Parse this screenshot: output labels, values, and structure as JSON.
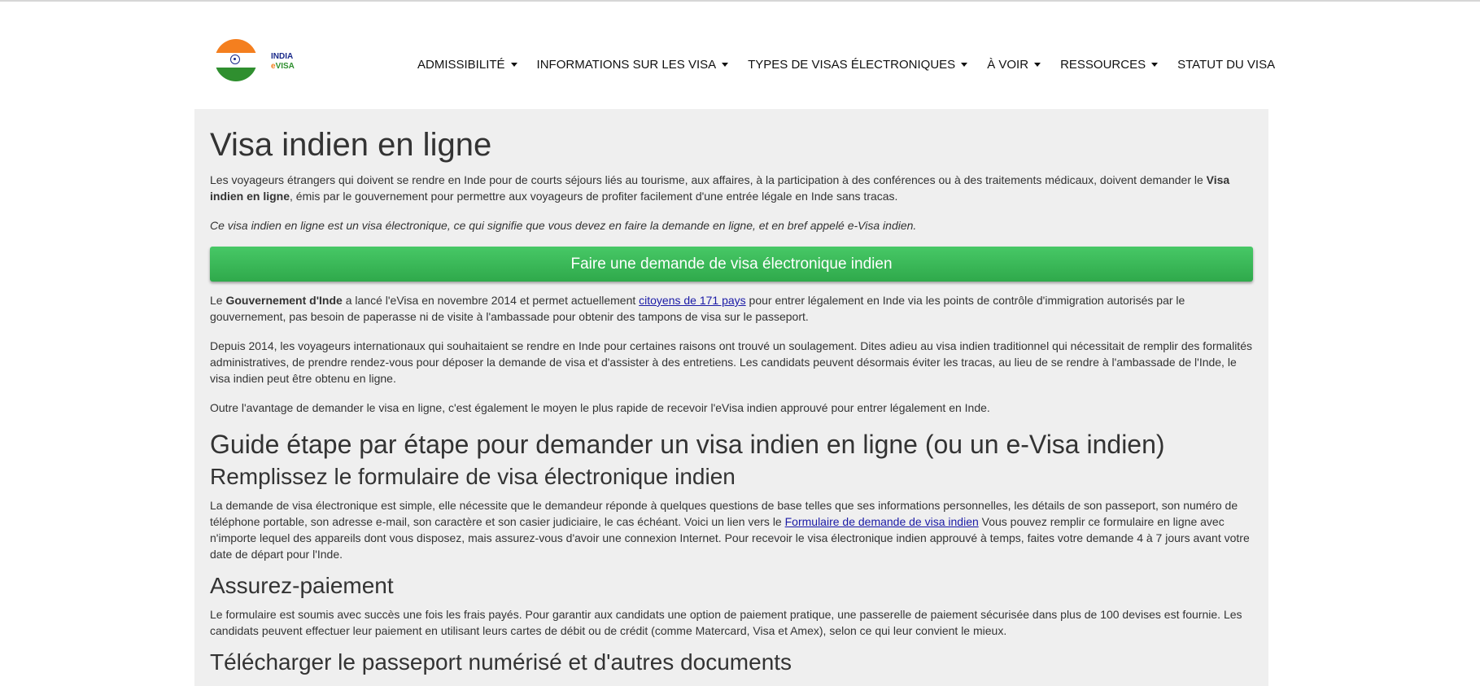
{
  "logo": {
    "line1": "INDIA",
    "line2_e": "e",
    "line2_visa": "VISA"
  },
  "nav": {
    "items": [
      {
        "label": "ADMISSIBILITÉ",
        "has_dropdown": true
      },
      {
        "label": "INFORMATIONS SUR LES VISA",
        "has_dropdown": true
      },
      {
        "label": "TYPES DE VISAS ÉLECTRONIQUES",
        "has_dropdown": true
      },
      {
        "label": "À VOIR",
        "has_dropdown": true
      },
      {
        "label": "RESSOURCES",
        "has_dropdown": true
      },
      {
        "label": "STATUT DU VISA",
        "has_dropdown": false
      }
    ]
  },
  "main": {
    "title": "Visa indien en ligne",
    "intro_before": "Les voyageurs étrangers qui doivent se rendre en Inde pour de courts séjours liés au tourisme, aux affaires, à la participation à des conférences ou à des traitements médicaux, doivent demander le ",
    "intro_bold": "Visa indien en ligne",
    "intro_after": ", émis par le gouvernement pour permettre aux voyageurs de profiter facilement d'une entrée légale en Inde sans tracas.",
    "italic_note": "Ce visa indien en ligne est un visa électronique, ce qui signifie que vous devez en faire la demande en ligne, et en bref appelé e-Visa indien.",
    "apply_button": "Faire une demande de visa électronique indien",
    "gov_before": "Le ",
    "gov_bold": "Gouvernement d'Inde",
    "gov_mid": " a lancé l'eVisa en novembre 2014 et permet actuellement ",
    "gov_link": "citoyens de 171 pays",
    "gov_after": " pour entrer légalement en Inde via les points de contrôle d'immigration autorisés par le gouvernement, pas besoin de paperasse ni de visite à l'ambassade pour obtenir des tampons de visa sur le passeport.",
    "since2014": "Depuis 2014, les voyageurs internationaux qui souhaitaient se rendre en Inde pour certaines raisons ont trouvé un soulagement. Dites adieu au visa indien traditionnel qui nécessitait de remplir des formalités administratives, de prendre rendez-vous pour déposer la demande de visa et d'assister à des entretiens. Les candidats peuvent désormais éviter les tracas, au lieu de se rendre à l'ambassade de l'Inde, le visa indien peut être obtenu en ligne.",
    "advantage": "Outre l'avantage de demander le visa en ligne, c'est également le moyen le plus rapide de recevoir l'eVisa indien approuvé pour entrer légalement en Inde.",
    "guide_title": "Guide étape par étape pour demander un visa indien en ligne (ou un e-Visa indien)",
    "step1_title": "Remplissez le formulaire de visa électronique indien",
    "step1_before": "La demande de visa électronique est simple, elle nécessite que le demandeur réponde à quelques questions de base telles que ses informations personnelles, les détails de son passeport, son numéro de téléphone portable, son adresse e-mail, son caractère et son casier judiciaire, le cas échéant. Voici un lien vers le ",
    "step1_link": "Formulaire de demande de visa indien",
    "step1_after": " Vous pouvez remplir ce formulaire en ligne avec n'importe lequel des appareils dont vous disposez, mais assurez-vous d'avoir une connexion Internet. Pour recevoir le visa électronique indien approuvé à temps, faites votre demande 4 à 7 jours avant votre date de départ pour l'Inde.",
    "step2_title": "Assurez-paiement",
    "step2_text": "Le formulaire est soumis avec succès une fois les frais payés. Pour garantir aux candidats une option de paiement pratique, une passerelle de paiement sécurisée dans plus de 100 devises est fournie. Les candidats peuvent effectuer leur paiement en utilisant leurs cartes de débit ou de crédit (comme Matercard, Visa et Amex), selon ce qui leur convient le mieux.",
    "step3_title": "Télécharger le passeport numérisé et d'autres documents"
  }
}
